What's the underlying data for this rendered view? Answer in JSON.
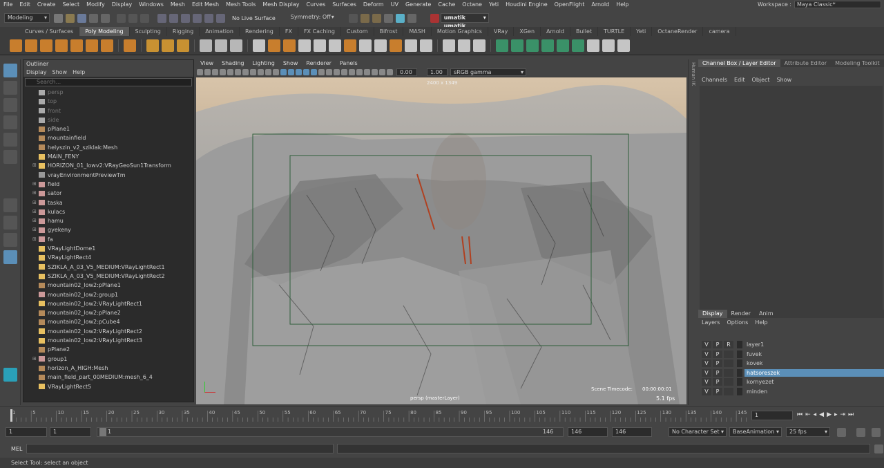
{
  "menu": [
    "File",
    "Edit",
    "Create",
    "Select",
    "Modify",
    "Display",
    "Windows",
    "Mesh",
    "Edit Mesh",
    "Mesh Tools",
    "Mesh Display",
    "Curves",
    "Surfaces",
    "Deform",
    "UV",
    "Generate",
    "Cache",
    "Octane",
    "Yeti",
    "Houdini Engine",
    "OpenFlight",
    "Arnold",
    "Help"
  ],
  "workspace": {
    "label": "Workspace :",
    "value": "Maya Classic*"
  },
  "status": {
    "mode": "Modeling",
    "live_surface": "No Live Surface",
    "symmetry": "Symmetry: Off",
    "user": "umatik umatik"
  },
  "shelf_tabs": [
    "Curves / Surfaces",
    "Poly Modeling",
    "Sculpting",
    "Rigging",
    "Animation",
    "Rendering",
    "FX",
    "FX Caching",
    "Custom",
    "Bifrost",
    "MASH",
    "Motion Graphics",
    "VRay",
    "XGen",
    "Arnold",
    "Bullet",
    "TURTLE",
    "Yeti",
    "OctaneRender",
    "camera"
  ],
  "shelf_active": "Poly Modeling",
  "outliner": {
    "title": "Outliner",
    "menu": [
      "Display",
      "Show",
      "Help"
    ],
    "search_placeholder": "Search...",
    "items": [
      {
        "name": "persp",
        "dim": true,
        "exp": false,
        "icon": "camera"
      },
      {
        "name": "top",
        "dim": true,
        "exp": false,
        "icon": "camera"
      },
      {
        "name": "front",
        "dim": true,
        "exp": false,
        "icon": "camera"
      },
      {
        "name": "side",
        "dim": true,
        "exp": false,
        "icon": "camera"
      },
      {
        "name": "pPlane1",
        "dim": false,
        "exp": false,
        "icon": "mesh"
      },
      {
        "name": "mountainfield",
        "dim": false,
        "exp": false,
        "icon": "mesh"
      },
      {
        "name": "helyszin_v2_sziklak:Mesh",
        "dim": false,
        "exp": false,
        "icon": "mesh"
      },
      {
        "name": "MAIN_FENY",
        "dim": false,
        "exp": false,
        "icon": "light"
      },
      {
        "name": "HORIZON_01_lowv2:VRayGeoSun1Transform",
        "dim": false,
        "exp": true,
        "icon": "sun"
      },
      {
        "name": "vrayEnvironmentPreviewTm",
        "dim": false,
        "exp": false,
        "icon": "env"
      },
      {
        "name": "field",
        "dim": false,
        "exp": true,
        "icon": "group"
      },
      {
        "name": "sator",
        "dim": false,
        "exp": true,
        "icon": "group"
      },
      {
        "name": "taska",
        "dim": false,
        "exp": true,
        "icon": "group"
      },
      {
        "name": "kulacs",
        "dim": false,
        "exp": true,
        "icon": "group"
      },
      {
        "name": "hamu",
        "dim": false,
        "exp": true,
        "icon": "group"
      },
      {
        "name": "gyekeny",
        "dim": false,
        "exp": true,
        "icon": "group"
      },
      {
        "name": "fa",
        "dim": false,
        "exp": true,
        "icon": "group"
      },
      {
        "name": "VRayLightDome1",
        "dim": false,
        "exp": false,
        "icon": "dome"
      },
      {
        "name": "VRayLightRect4",
        "dim": false,
        "exp": false,
        "icon": "light"
      },
      {
        "name": "SZIKLA_A_03_V5_MEDIUM:VRayLightRect1",
        "dim": false,
        "exp": false,
        "icon": "light"
      },
      {
        "name": "SZIKLA_A_03_V5_MEDIUM:VRayLightRect2",
        "dim": false,
        "exp": false,
        "icon": "light"
      },
      {
        "name": "mountain02_low2:pPlane1",
        "dim": false,
        "exp": false,
        "icon": "mesh"
      },
      {
        "name": "mountain02_low2:group1",
        "dim": false,
        "exp": false,
        "icon": "group"
      },
      {
        "name": "mountain02_low2:VRayLightRect1",
        "dim": false,
        "exp": false,
        "icon": "light"
      },
      {
        "name": "mountain02_low2:pPlane2",
        "dim": false,
        "exp": false,
        "icon": "mesh"
      },
      {
        "name": "mountain02_low2:pCube4",
        "dim": false,
        "exp": false,
        "icon": "mesh"
      },
      {
        "name": "mountain02_low2:VRayLightRect2",
        "dim": false,
        "exp": false,
        "icon": "light"
      },
      {
        "name": "mountain02_low2:VRayLightRect3",
        "dim": false,
        "exp": false,
        "icon": "light"
      },
      {
        "name": "pPlane2",
        "dim": false,
        "exp": false,
        "icon": "mesh"
      },
      {
        "name": "group1",
        "dim": false,
        "exp": true,
        "icon": "group"
      },
      {
        "name": "horizon_A_HIGH:Mesh",
        "dim": false,
        "exp": false,
        "icon": "mesh"
      },
      {
        "name": "main_field_part_00MEDIUM:mesh_6_4",
        "dim": false,
        "exp": false,
        "icon": "mesh"
      },
      {
        "name": "VRayLightRect5",
        "dim": false,
        "exp": false,
        "icon": "light"
      }
    ]
  },
  "viewport": {
    "menu": [
      "View",
      "Shading",
      "Lighting",
      "Show",
      "Renderer",
      "Panels"
    ],
    "exposure": "0.00",
    "gamma": "1.00",
    "colorspace": "sRGB gamma",
    "resolution": "2400 x 1349",
    "camera": "persp (masterLayer)",
    "timecode_label": "Scene Timecode:",
    "timecode": "00:00:00:01",
    "fps": "5.1 fps"
  },
  "humanik": "Human IK",
  "channelbox": {
    "tabs": [
      "Channel Box / Layer Editor",
      "Attribute Editor",
      "Modeling Toolkit"
    ],
    "menu": [
      "Channels",
      "Edit",
      "Object",
      "Show"
    ]
  },
  "layer_editor": {
    "tabs": [
      "Display",
      "Render",
      "Anim"
    ],
    "menu": [
      "Layers",
      "Options",
      "Help"
    ],
    "layers": [
      {
        "v": "V",
        "p": "P",
        "r": "R",
        "name": "layer1",
        "sel": false
      },
      {
        "v": "V",
        "p": "P",
        "r": "",
        "name": "fuvek",
        "sel": false
      },
      {
        "v": "V",
        "p": "P",
        "r": "",
        "name": "kovek",
        "sel": false
      },
      {
        "v": "V",
        "p": "P",
        "r": "",
        "name": "hatsoreszek",
        "sel": true
      },
      {
        "v": "V",
        "p": "P",
        "r": "",
        "name": "kornyezet",
        "sel": false
      },
      {
        "v": "V",
        "p": "P",
        "r": "",
        "name": "minden",
        "sel": false
      }
    ]
  },
  "timeline": {
    "ticks": [
      "1",
      "5",
      "10",
      "15",
      "20",
      "25",
      "30",
      "35",
      "40",
      "45",
      "50",
      "55",
      "60",
      "65",
      "70",
      "75",
      "80",
      "85",
      "90",
      "95",
      "100",
      "105",
      "110",
      "115",
      "120",
      "125",
      "130",
      "135",
      "140",
      "145"
    ],
    "current": "1"
  },
  "range": {
    "start": "1",
    "inner_start": "1",
    "slider_start": "1",
    "slider_end": "146",
    "inner_end": "146",
    "end": "146",
    "character_set": "No Character Set",
    "anim_layer": "BaseAnimation",
    "fps": "25 fps"
  },
  "cmd": {
    "label": "MEL"
  },
  "help": "Select Tool: select an object"
}
